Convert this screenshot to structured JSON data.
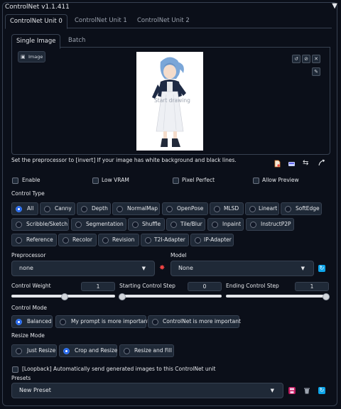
{
  "header": {
    "title": "ControlNet v1.1.411",
    "collapse_icon": "triangle-down-icon"
  },
  "unit_tabs": [
    {
      "label": "ControlNet Unit 0",
      "active": true
    },
    {
      "label": "ControlNet Unit 1",
      "active": false
    },
    {
      "label": "ControlNet Unit 2",
      "active": false
    }
  ],
  "input_tabs": [
    {
      "label": "Single Image",
      "active": true
    },
    {
      "label": "Batch",
      "active": false
    }
  ],
  "image_panel": {
    "chip_label": "Image",
    "canvas_hint": "Start drawing",
    "tools": [
      "undo-icon",
      "erase-icon",
      "close-icon"
    ],
    "brush_icon": "brush-icon"
  },
  "note": "Set the preprocessor to [invert] If your image has white background and black lines.",
  "action_icons": [
    "new-document-icon",
    "camera-icon",
    "swap-icon",
    "curve-arrow-icon"
  ],
  "checkboxes": {
    "enable": "Enable",
    "low_vram": "Low VRAM",
    "pixel_perfect": "Pixel Perfect",
    "allow_preview": "Allow Preview"
  },
  "control_type": {
    "label": "Control Type",
    "selected": "All",
    "rows": [
      [
        "All",
        "Canny",
        "Depth",
        "NormalMap",
        "OpenPose",
        "MLSD",
        "Lineart",
        "SoftEdge"
      ],
      [
        "Scribble/Sketch",
        "Segmentation",
        "Shuffle",
        "Tile/Blur",
        "Inpaint",
        "InstructP2P"
      ],
      [
        "Reference",
        "Recolor",
        "Revision",
        "T2I-Adapter",
        "IP-Adapter"
      ]
    ]
  },
  "preprocessor": {
    "label": "Preprocessor",
    "value": "none"
  },
  "model": {
    "label": "Model",
    "value": "None"
  },
  "sliders": {
    "control_weight": {
      "label": "Control Weight",
      "value": "1",
      "fraction": 0.5
    },
    "starting_step": {
      "label": "Starting Control Step",
      "value": "0",
      "fraction": 0.0
    },
    "ending_step": {
      "label": "Ending Control Step",
      "value": "1",
      "fraction": 1.0
    }
  },
  "control_mode": {
    "label": "Control Mode",
    "options": [
      "Balanced",
      "My prompt is more important",
      "ControlNet is more important"
    ],
    "selected": "Balanced"
  },
  "resize_mode": {
    "label": "Resize Mode",
    "options": [
      "Just Resize",
      "Crop and Resize",
      "Resize and Fill"
    ],
    "selected": "Crop and Resize"
  },
  "loopback": "[Loopback] Automatically send generated images to this ControlNet unit",
  "presets": {
    "label": "Presets",
    "value": "New Preset"
  },
  "colors": {
    "accent": "#2563eb",
    "background": "#0b0f19",
    "panel_border": "#374151",
    "fire": "#ef4444"
  }
}
